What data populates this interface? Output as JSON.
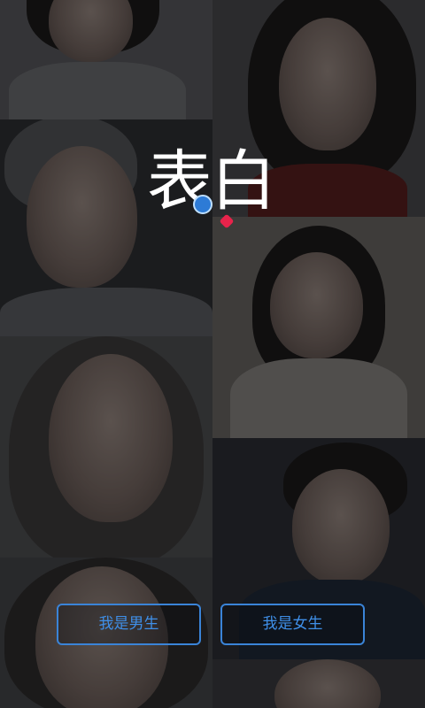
{
  "logo": {
    "text": "表白"
  },
  "buttons": {
    "male_label": "我是男生",
    "female_label": "我是女生"
  },
  "colors": {
    "accent": "#3A84D8",
    "background": "#141416",
    "logo_heart": "#E8234B"
  }
}
